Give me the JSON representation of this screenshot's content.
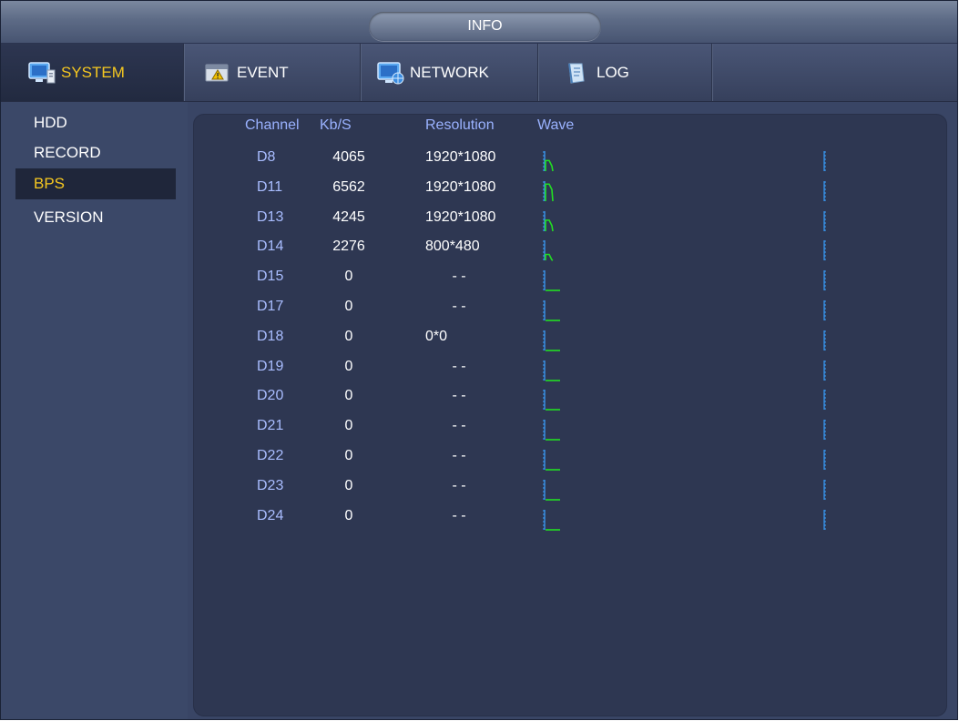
{
  "window": {
    "title": "INFO"
  },
  "tabs": [
    {
      "label": "SYSTEM",
      "icon": "monitor-icon",
      "active": true
    },
    {
      "label": "EVENT",
      "icon": "event-icon",
      "active": false
    },
    {
      "label": "NETWORK",
      "icon": "network-icon",
      "active": false
    },
    {
      "label": "LOG",
      "icon": "log-icon",
      "active": false
    }
  ],
  "sidebar": {
    "items": [
      {
        "label": "HDD",
        "active": false
      },
      {
        "label": "RECORD",
        "active": false
      },
      {
        "label": "BPS",
        "active": true
      },
      {
        "label": "VERSION",
        "active": false
      }
    ]
  },
  "table": {
    "headers": {
      "channel": "Channel",
      "kbs": "Kb/S",
      "resolution": "Resolution",
      "wave": "Wave"
    },
    "rows": [
      {
        "channel": "D8",
        "kbs": "4065",
        "resolution": "1920*1080",
        "wave": "active"
      },
      {
        "channel": "D11",
        "kbs": "6562",
        "resolution": "1920*1080",
        "wave": "active"
      },
      {
        "channel": "D13",
        "kbs": "4245",
        "resolution": "1920*1080",
        "wave": "active"
      },
      {
        "channel": "D14",
        "kbs": "2276",
        "resolution": "800*480",
        "wave": "active"
      },
      {
        "channel": "D15",
        "kbs": "0",
        "resolution": "- -",
        "wave": "idle"
      },
      {
        "channel": "D17",
        "kbs": "0",
        "resolution": "- -",
        "wave": "idle"
      },
      {
        "channel": "D18",
        "kbs": "0",
        "resolution": "0*0",
        "wave": "idle"
      },
      {
        "channel": "D19",
        "kbs": "0",
        "resolution": "- -",
        "wave": "idle"
      },
      {
        "channel": "D20",
        "kbs": "0",
        "resolution": "- -",
        "wave": "idle"
      },
      {
        "channel": "D21",
        "kbs": "0",
        "resolution": "- -",
        "wave": "idle"
      },
      {
        "channel": "D22",
        "kbs": "0",
        "resolution": "- -",
        "wave": "idle"
      },
      {
        "channel": "D23",
        "kbs": "0",
        "resolution": "- -",
        "wave": "idle"
      },
      {
        "channel": "D24",
        "kbs": "0",
        "resolution": "- -",
        "wave": "idle"
      }
    ]
  },
  "colors": {
    "accent": "#f6c820",
    "header_text": "#9ab2ff",
    "wave_active": "#22dd22",
    "wave_idle": "#3aa0ff"
  }
}
